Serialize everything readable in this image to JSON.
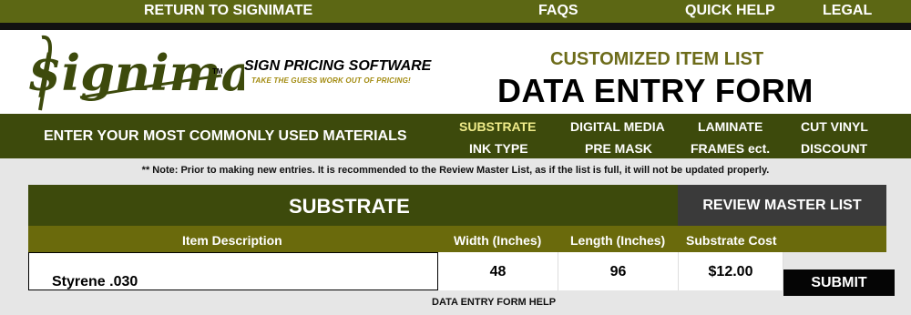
{
  "topnav": {
    "return": "RETURN TO SIGNIMATE",
    "faqs": "FAQS",
    "quick_help": "QUICK HELP",
    "legal": "LEGAL"
  },
  "header": {
    "logo_text": "$ignimate",
    "logo_tm": "TM",
    "tagline": "SIGN PRICING SOFTWARE",
    "subtagline": "TAKE THE GUESS WORK OUT OF PRICING!",
    "form_subtitle": "CUSTOMIZED ITEM LIST",
    "form_title": "DATA ENTRY FORM"
  },
  "categories": {
    "prompt": "ENTER YOUR MOST COMMONLY USED MATERIALS",
    "items": [
      "SUBSTRATE",
      "DIGITAL MEDIA",
      "LAMINATE",
      "CUT VINYL",
      "INK TYPE",
      "PRE MASK",
      "FRAMES ect.",
      "DISCOUNT"
    ]
  },
  "note": "** Note: Prior to making new entries. It is recommended to the Review Master List, as if the list is full, it will not be updated properly.",
  "section": {
    "title": "SUBSTRATE",
    "review_button": "REVIEW MASTER LIST"
  },
  "table": {
    "headers": [
      "Item Description",
      "Width (Inches)",
      "Length (Inches)",
      "Substrate Cost"
    ],
    "row": {
      "description": "Styrene .030",
      "width": "48",
      "length": "96",
      "cost": "$12.00"
    }
  },
  "submit_label": "SUBMIT",
  "help_link": "DATA ENTRY FORM HELP",
  "colors": {
    "olive_dark": "#3d4a0c",
    "olive_mid": "#5c6714",
    "olive_header": "#6a6a0c",
    "active_category": "#f0ec8a"
  }
}
